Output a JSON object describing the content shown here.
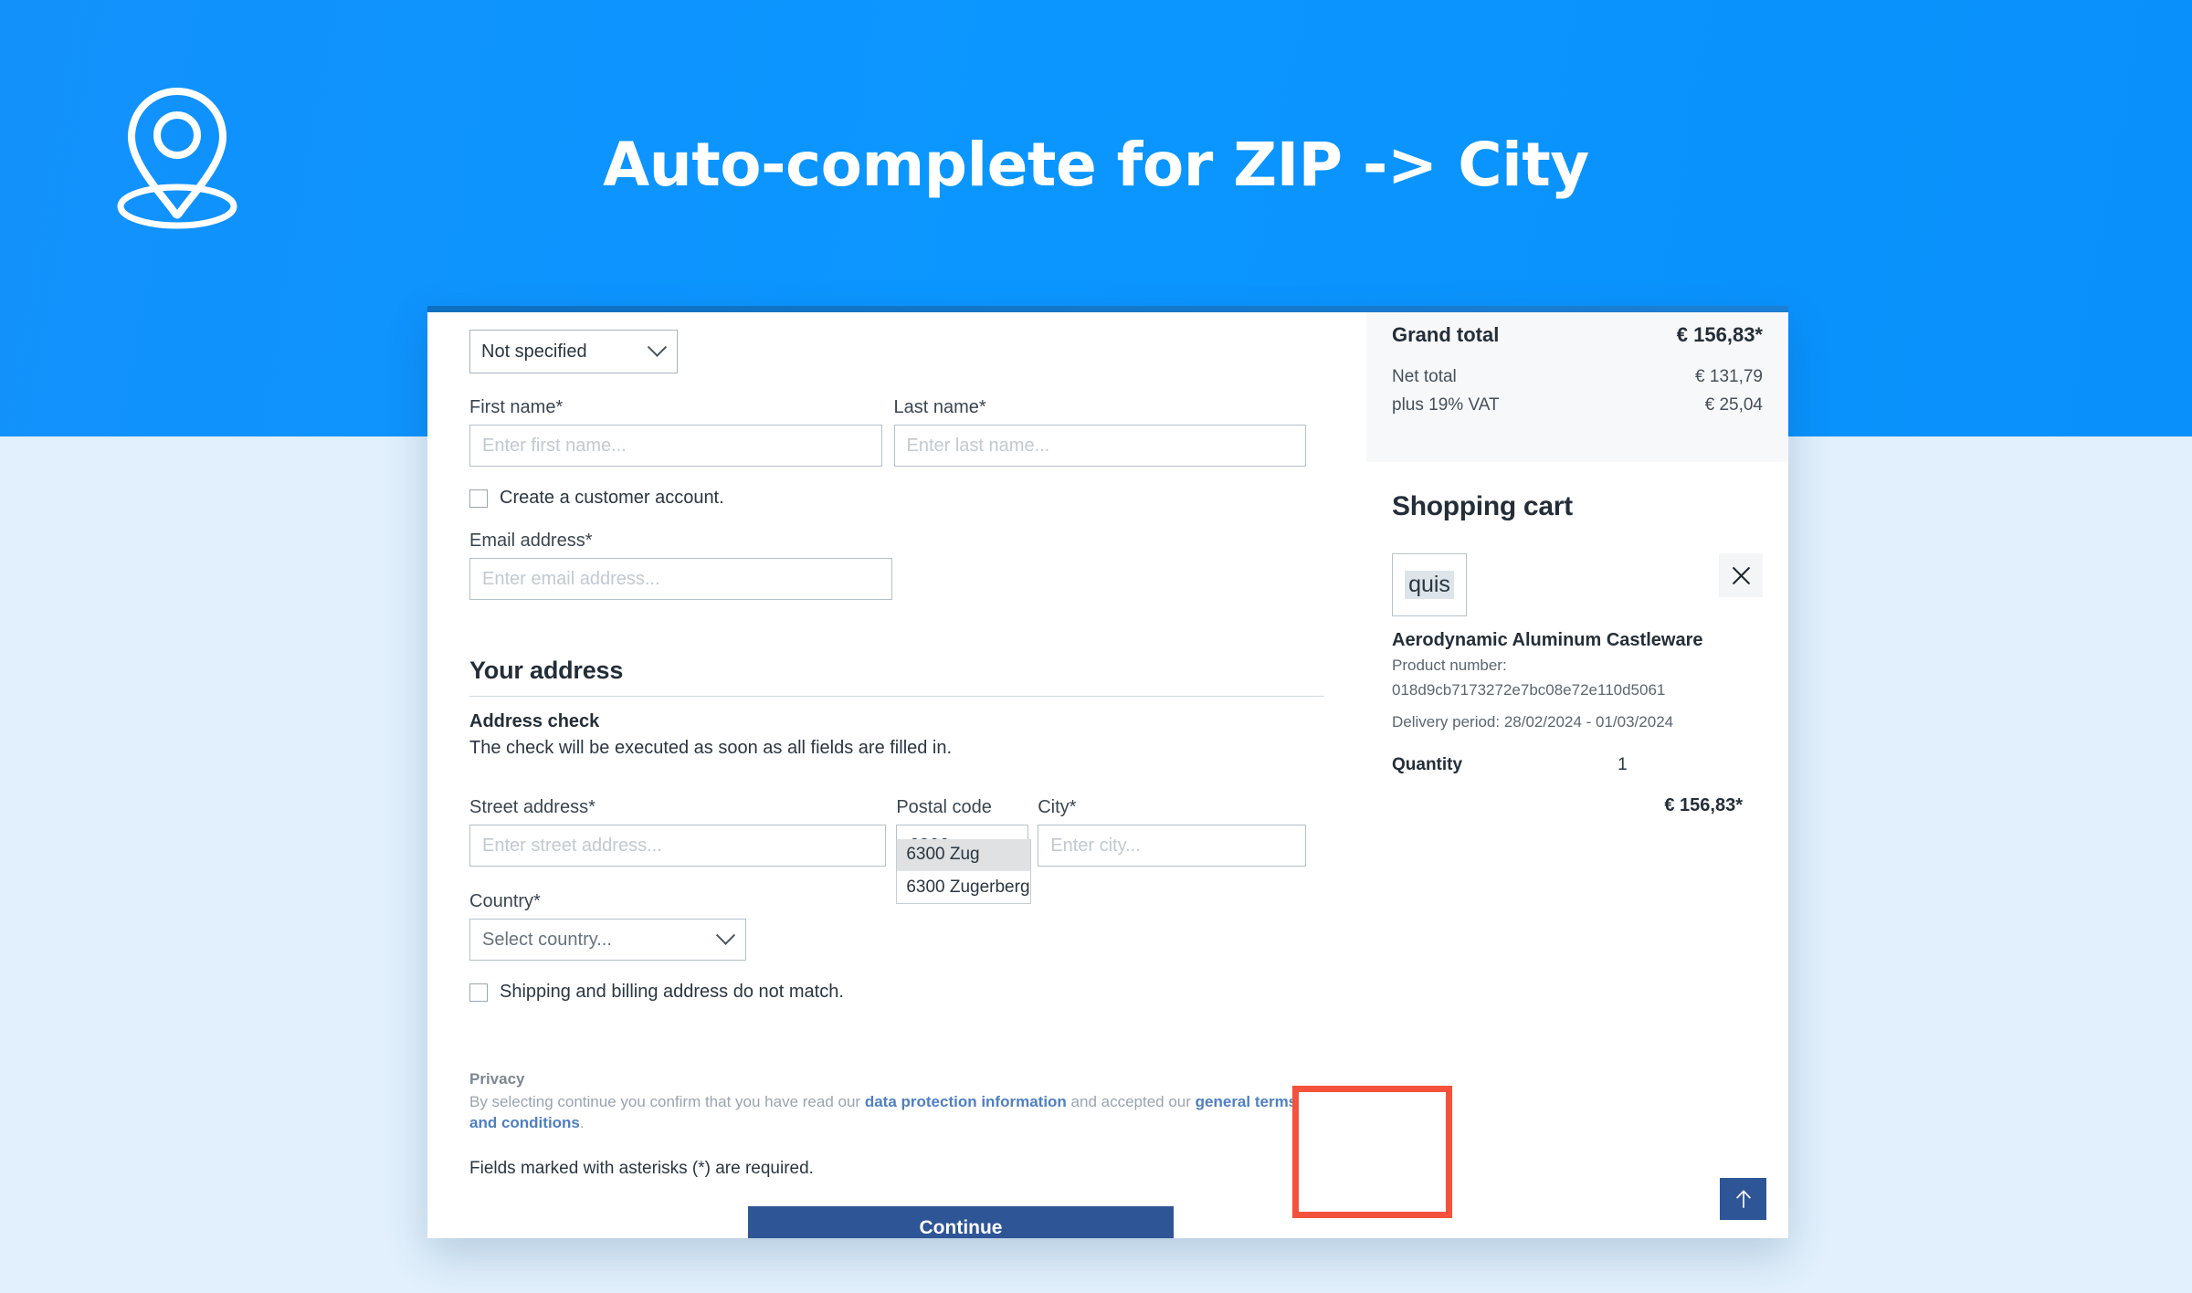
{
  "hero": {
    "title": "Auto-complete for ZIP -> City",
    "icon": "map-pin-icon",
    "bg_color": "#0d93fb"
  },
  "page": {
    "background_color": "#e1f0fc"
  },
  "checkout": {
    "salutation": {
      "value": "Not specified"
    },
    "first_name": {
      "label": "First name*",
      "placeholder": "Enter first name...",
      "value": ""
    },
    "last_name": {
      "label": "Last name*",
      "placeholder": "Enter last name...",
      "value": ""
    },
    "create_account": {
      "label": "Create a customer account.",
      "checked": false
    },
    "email": {
      "label": "Email address*",
      "placeholder": "Enter email address...",
      "value": ""
    },
    "address_section": {
      "heading": "Your address",
      "check_title": "Address check",
      "check_text": "The check will be executed as soon as all fields are filled in."
    },
    "street": {
      "label": "Street address*",
      "placeholder": "Enter street address...",
      "value": ""
    },
    "postal_code": {
      "label": "Postal code",
      "value": "6300",
      "suggestions": [
        {
          "text": "6300 Zug",
          "selected": true
        },
        {
          "text": "6300 Zugerberg",
          "selected": false
        }
      ],
      "highlight_color": "#f4523b"
    },
    "city": {
      "label": "City*",
      "placeholder": "Enter city...",
      "value": ""
    },
    "country": {
      "label": "Country*",
      "placeholder": "Select country...",
      "value": ""
    },
    "shipping_differs": {
      "label": "Shipping and billing address do not match.",
      "checked": false
    },
    "privacy": {
      "title": "Privacy",
      "text_before": "By selecting continue you confirm that you have read our ",
      "link1": "data protection information",
      "text_middle": " and accepted our ",
      "link2": "general terms and conditions",
      "text_after": "."
    },
    "asterisk_note": "Fields marked with asterisks (*) are required.",
    "continue_button": "Continue"
  },
  "cart": {
    "totals": [
      {
        "label": "Grand total",
        "value": "€ 156,83*",
        "emphasis": true
      },
      {
        "label": "Net total",
        "value": "€ 131,79",
        "emphasis": false
      },
      {
        "label": "plus 19% VAT",
        "value": "€ 25,04",
        "emphasis": false
      }
    ],
    "heading": "Shopping cart",
    "item": {
      "thumb_text": "quis",
      "name": "Aerodynamic Aluminum Castleware",
      "product_number_label": "Product number:",
      "product_number": "018d9cb7173272e7bc08e72e110d5061",
      "delivery": "Delivery period: 28/02/2024 - 01/03/2024",
      "quantity_label": "Quantity",
      "quantity_value": "1",
      "price": "€ 156,83*"
    },
    "remove_icon": "close-icon"
  },
  "scroll_top": {
    "icon": "arrow-up-icon",
    "color": "#2e5596"
  }
}
